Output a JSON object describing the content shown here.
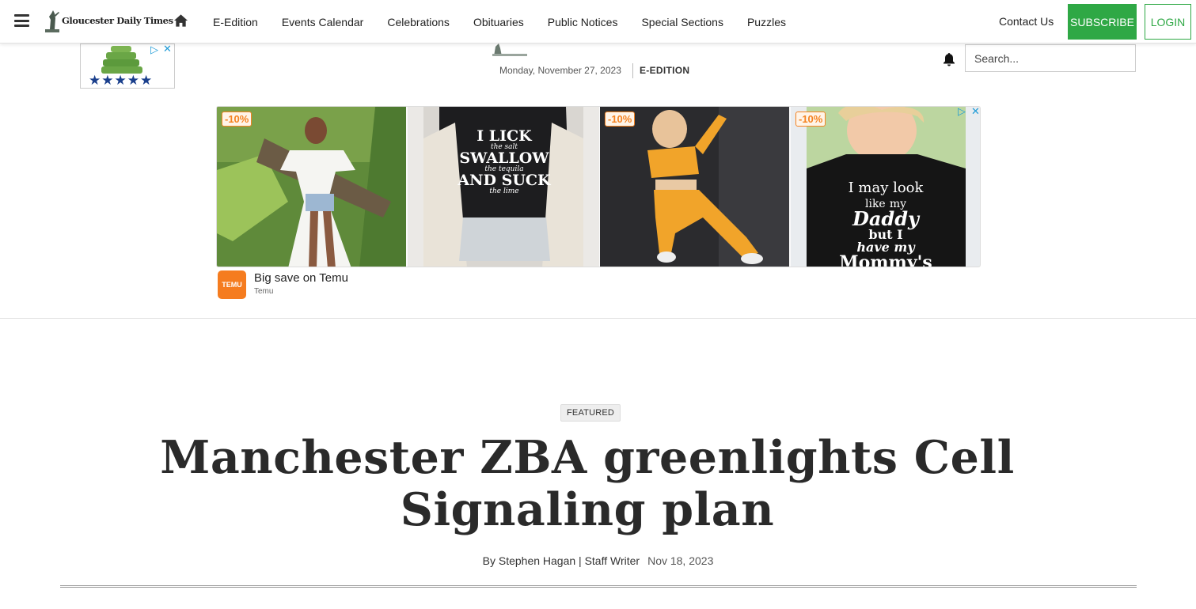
{
  "nav": {
    "logo_text": "Gloucester Daily Times",
    "links": [
      "E-Edition",
      "Events Calendar",
      "Celebrations",
      "Obituaries",
      "Public Notices",
      "Special Sections",
      "Puzzles"
    ],
    "contact": "Contact Us",
    "subscribe": "SUBSCRIBE",
    "login": "LOGIN"
  },
  "masthead": {
    "date": "Monday, November 27, 2023",
    "eedition": "E-EDITION",
    "search_placeholder": "Search..."
  },
  "small_ad": {
    "stars": "★★★★★"
  },
  "ad": {
    "discounts": [
      "-10%",
      "-10%",
      "-10%"
    ],
    "shirt1": [
      "I LICK",
      "the salt",
      "SWALLOW",
      "the tequila",
      "AND SUCK",
      "the lime"
    ],
    "shirt2": [
      "I may look",
      "like",
      "my",
      "Daddy",
      "but I",
      "have my",
      "Mommy's"
    ],
    "logo_text": "TEMU",
    "title": "Big save on Temu",
    "sub": "Temu"
  },
  "article": {
    "badge": "FEATURED",
    "headline": "Manchester ZBA greenlights Cell Signaling plan",
    "byline": "By Stephen Hagan | Staff Writer",
    "date": "Nov 18, 2023"
  },
  "colors": {
    "accent": "#2fa845",
    "ad_orange": "#f58220",
    "adchoice_blue": "#1e9bd7"
  }
}
